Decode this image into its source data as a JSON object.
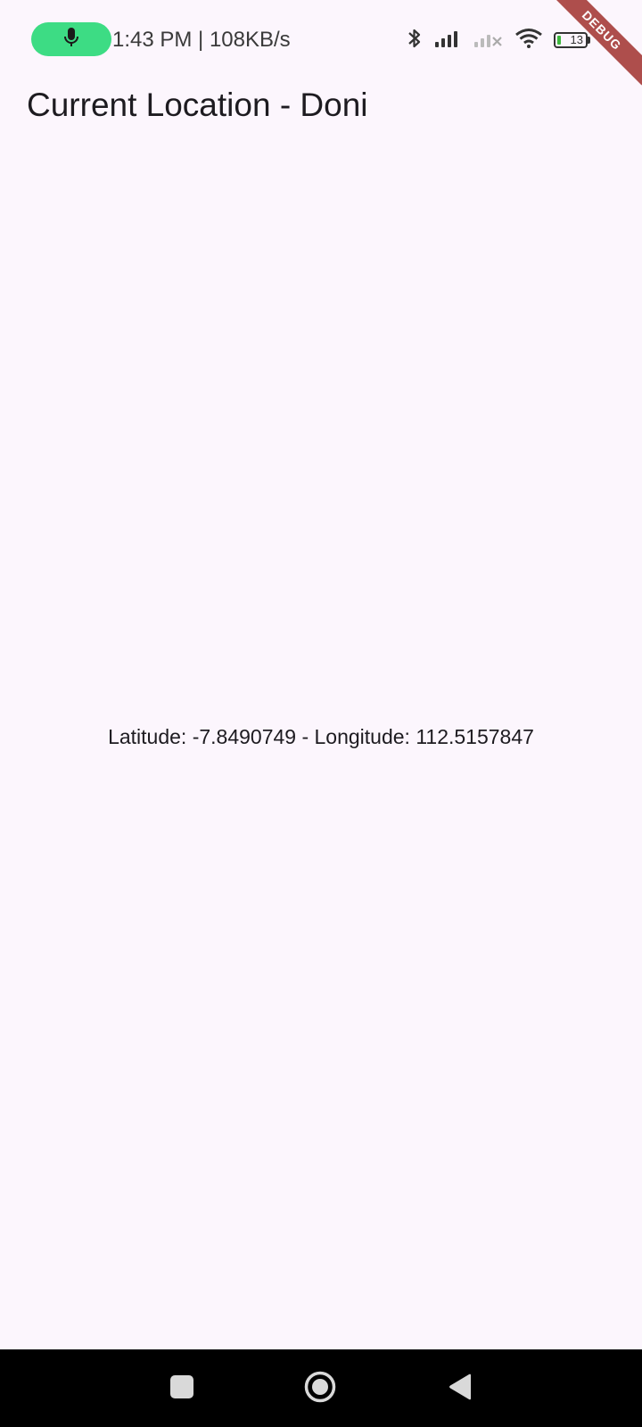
{
  "status_bar": {
    "time_speed": "1:43 PM | 108KB/s",
    "battery_level": "13",
    "icons": [
      "mic-icon",
      "bluetooth-icon",
      "signal-icon",
      "signal-off-icon",
      "wifi-icon",
      "battery-icon"
    ],
    "mic_pill_color": "#3DDC84"
  },
  "debug_banner": {
    "label": "DEBUG",
    "color": "#A8403E"
  },
  "app_bar": {
    "title": "Current Location - Doni"
  },
  "body": {
    "location_text": "Latitude: -7.8490749 - Longitude: 112.5157847"
  },
  "nav_bar": {
    "buttons": [
      "recents-icon",
      "home-icon",
      "back-icon"
    ]
  },
  "colors": {
    "background": "#FCF6FD",
    "text": "#1D1B20"
  }
}
